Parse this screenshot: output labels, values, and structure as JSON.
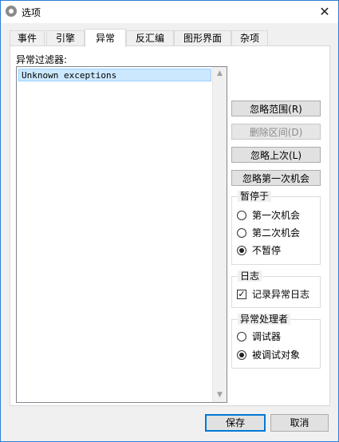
{
  "window": {
    "title": "选项",
    "title_icon": "gear-icon",
    "close_icon": "close-icon",
    "close_glyph": "✕"
  },
  "tabs": [
    {
      "label": "事件"
    },
    {
      "label": "引擎"
    },
    {
      "label": "异常",
      "active": true
    },
    {
      "label": "反汇编"
    },
    {
      "label": "图形界面"
    },
    {
      "label": "杂项"
    }
  ],
  "filter": {
    "label": "异常过滤器:",
    "items": [
      "Unknown exceptions"
    ]
  },
  "buttons": {
    "ignore_range": "忽略范围(R)",
    "delete_range": "删除区间(D)",
    "ignore_last": "忽略上次(L)",
    "ignore_first_chance": "忽略第一次机会"
  },
  "pause_group": {
    "title": "暂停于",
    "options": [
      {
        "label": "第一次机会",
        "checked": false
      },
      {
        "label": "第二次机会",
        "checked": false
      },
      {
        "label": "不暂停",
        "checked": true
      }
    ]
  },
  "log_group": {
    "title": "日志",
    "checkbox_label": "记录异常日志",
    "checked": true,
    "check_glyph": "✓"
  },
  "handler_group": {
    "title": "异常处理者",
    "options": [
      {
        "label": "调试器",
        "checked": false
      },
      {
        "label": "被调试对象",
        "checked": true
      }
    ]
  },
  "footer": {
    "ok": "保存",
    "cancel": "取消"
  },
  "scrollbar": {
    "up_glyph": "▲",
    "down_glyph": "▼"
  }
}
